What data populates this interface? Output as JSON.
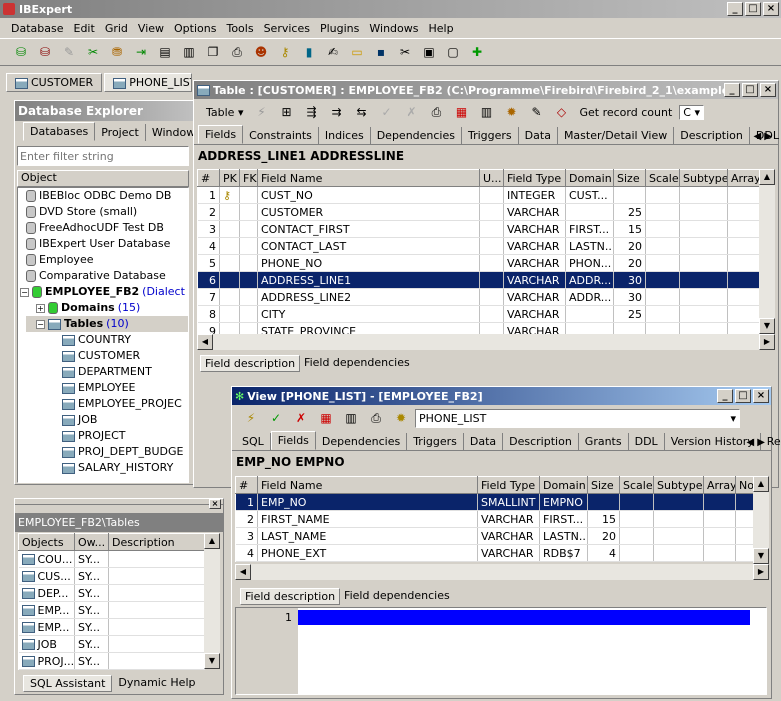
{
  "app": {
    "title": "IBExpert",
    "menu": [
      "Database",
      "Edit",
      "Grid",
      "View",
      "Options",
      "Tools",
      "Services",
      "Plugins",
      "Windows",
      "Help"
    ]
  },
  "doc_tabs": [
    "CUSTOMER",
    "PHONE_LIST"
  ],
  "explorer": {
    "title": "Database Explorer",
    "tabs": [
      "Databases",
      "Project",
      "Window"
    ],
    "filter_placeholder": "Enter filter string",
    "column": "Object",
    "databases": [
      "IBEBloc ODBC Demo DB",
      "DVD Store (small)",
      "FreeAdhocUDF Test DB",
      "IBExpert User Database",
      "Employee",
      "Comparative Database"
    ],
    "active_db": "EMPLOYEE_FB2",
    "active_db_suffix": "(Dialect",
    "domains_label": "Domains",
    "domains_count": "(15)",
    "tables_label": "Tables",
    "tables_count": "(10)",
    "tables": [
      "COUNTRY",
      "CUSTOMER",
      "DEPARTMENT",
      "EMPLOYEE",
      "EMPLOYEE_PROJEC",
      "JOB",
      "PROJECT",
      "PROJ_DEPT_BUDGE",
      "SALARY_HISTORY"
    ]
  },
  "objects_panel": {
    "title": "EMPLOYEE_FB2\\Tables",
    "headers": [
      "Objects",
      "Ow...",
      "Description"
    ],
    "rows": [
      [
        "COU...",
        "SY..."
      ],
      [
        "CUS...",
        "SY..."
      ],
      [
        "DEP...",
        "SY..."
      ],
      [
        "EMP...",
        "SY..."
      ],
      [
        "EMP...",
        "SY..."
      ],
      [
        "JOB",
        "SY..."
      ],
      [
        "PROJ...",
        "SY..."
      ]
    ],
    "bottom_tabs": [
      "SQL Assistant",
      "Dynamic Help"
    ]
  },
  "table_window": {
    "title": "Table : [CUSTOMER] : EMPLOYEE_FB2 (C:\\Programme\\Firebird\\Firebird_2_1\\examples\\E...",
    "toolbar": {
      "table_label": "Table",
      "get_record_count": "Get record count",
      "c_label": "C"
    },
    "tabs": [
      "Fields",
      "Constraints",
      "Indices",
      "Dependencies",
      "Triggers",
      "Data",
      "Master/Detail View",
      "Description",
      "DDL"
    ],
    "banner": "ADDRESS_LINE1 ADDRESSLINE",
    "headers": [
      "#",
      "PK",
      "FK",
      "Field Name",
      "U...",
      "Field Type",
      "Domain",
      "Size",
      "Scale",
      "Subtype",
      "Array"
    ],
    "rows": [
      {
        "n": "1",
        "pk": "key",
        "name": "CUST_NO",
        "type": "INTEGER",
        "domain": "CUST...",
        "size": ""
      },
      {
        "n": "2",
        "pk": "",
        "name": "CUSTOMER",
        "type": "VARCHAR",
        "domain": "",
        "size": "25"
      },
      {
        "n": "3",
        "pk": "",
        "name": "CONTACT_FIRST",
        "type": "VARCHAR",
        "domain": "FIRST...",
        "size": "15"
      },
      {
        "n": "4",
        "pk": "",
        "name": "CONTACT_LAST",
        "type": "VARCHAR",
        "domain": "LASTN...",
        "size": "20"
      },
      {
        "n": "5",
        "pk": "",
        "name": "PHONE_NO",
        "type": "VARCHAR",
        "domain": "PHON...",
        "size": "20"
      },
      {
        "n": "6",
        "pk": "",
        "name": "ADDRESS_LINE1",
        "type": "VARCHAR",
        "domain": "ADDR...",
        "size": "30"
      },
      {
        "n": "7",
        "pk": "",
        "name": "ADDRESS_LINE2",
        "type": "VARCHAR",
        "domain": "ADDR...",
        "size": "30"
      },
      {
        "n": "8",
        "pk": "",
        "name": "CITY",
        "type": "VARCHAR",
        "domain": "",
        "size": "25"
      },
      {
        "n": "9",
        "pk": "",
        "name": "STATE_PROVINCE",
        "type": "VARCHAR",
        "domain": "",
        "size": ""
      }
    ],
    "selected_row": 5,
    "bottom_tabs": [
      "Field description",
      "Field dependencies"
    ]
  },
  "view_window": {
    "title": "View [PHONE_LIST] - [EMPLOYEE_FB2]",
    "name_value": "PHONE_LIST",
    "tabs": [
      "SQL",
      "Fields",
      "Dependencies",
      "Triggers",
      "Data",
      "Description",
      "Grants",
      "DDL",
      "Version History",
      "Recre"
    ],
    "banner": "EMP_NO EMPNO",
    "headers": [
      "#",
      "Field Name",
      "Field Type",
      "Domain",
      "Size",
      "Scale",
      "Subtype",
      "Array",
      "No"
    ],
    "rows": [
      {
        "n": "1",
        "name": "EMP_NO",
        "type": "SMALLINT",
        "domain": "EMPNO",
        "size": ""
      },
      {
        "n": "2",
        "name": "FIRST_NAME",
        "type": "VARCHAR",
        "domain": "FIRST...",
        "size": "15"
      },
      {
        "n": "3",
        "name": "LAST_NAME",
        "type": "VARCHAR",
        "domain": "LASTN...",
        "size": "20"
      },
      {
        "n": "4",
        "name": "PHONE_EXT",
        "type": "VARCHAR",
        "domain": "RDB$7",
        "size": "4"
      }
    ],
    "selected_row": 0,
    "bottom_tabs": [
      "Field description",
      "Field dependencies"
    ],
    "editor_line": "1"
  }
}
